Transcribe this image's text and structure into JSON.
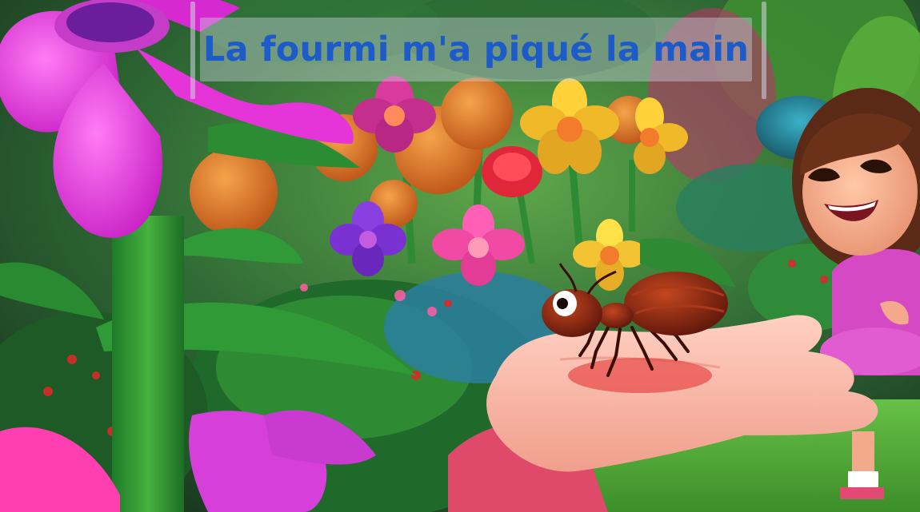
{
  "video": {
    "caption": "La fourmi m'a piqué la main"
  },
  "colors": {
    "caption_text": "#1d5bc8",
    "caption_bg": "#cdd2e1",
    "ant_body": "#8a2a14",
    "hand_skin": "#f6b7a7",
    "sleeve": "#e04a6a",
    "dress": "#d649c4"
  },
  "scene_elements": [
    "giant-pink-flower",
    "flower-garden",
    "red-ant",
    "open-hand",
    "smiling-girl"
  ]
}
